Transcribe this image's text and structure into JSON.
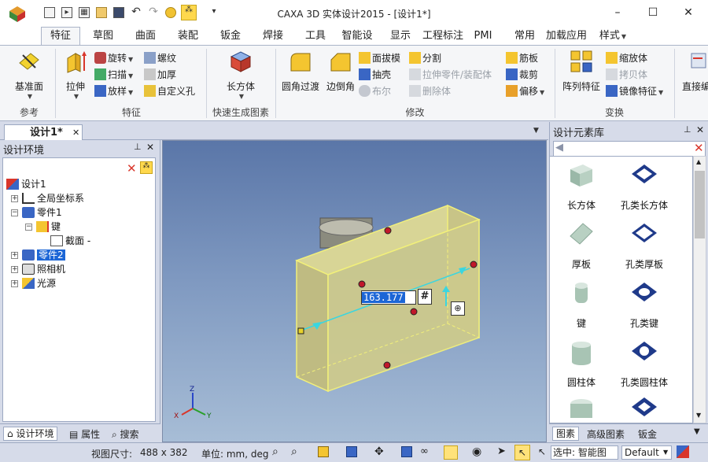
{
  "window": {
    "title": "CAXA 3D 实体设计2015 - [设计1*]",
    "minimize_icon": "minimize-icon",
    "maximize_icon": "maximize-icon",
    "close_icon": "close-icon"
  },
  "quick_access": [
    "new-icon",
    "open-icon",
    "print-icon",
    "folder-icon",
    "save-icon",
    "undo-icon",
    "redo-icon",
    "smart-icon",
    "catalog-icon",
    "customize-dropdown-icon"
  ],
  "ribbon_tabs": [
    {
      "label": "特征",
      "active": true
    },
    {
      "label": "草图"
    },
    {
      "label": "曲面"
    },
    {
      "label": "装配"
    },
    {
      "label": "钣金"
    },
    {
      "label": "焊接"
    },
    {
      "label": "工具"
    },
    {
      "label": "智能设计"
    },
    {
      "label": "显示"
    },
    {
      "label": "工程标注"
    },
    {
      "label": "PMI"
    },
    {
      "label": "常用"
    },
    {
      "label": "加载应用"
    },
    {
      "label": "样式"
    }
  ],
  "ribbon": {
    "ref_group": {
      "label": "参考",
      "base_plane": "基准面"
    },
    "feature_group": {
      "label": "特征",
      "extrude": "拉伸",
      "revolve": "旋转",
      "sweep": "扫描",
      "loft": "放样",
      "thread": "螺纹",
      "thicken": "加厚",
      "custom_hole": "自定义孔"
    },
    "quick_group": {
      "label": "快速生成图素",
      "block": "长方体"
    },
    "modify_group": {
      "label": "修改",
      "fillet": "圆角过渡",
      "chamfer": "边倒角",
      "draft": "面拔模",
      "shell": "抽壳",
      "boolean": "布尔",
      "split": "分割",
      "stretch_part": "拉伸零件/装配体",
      "delete_body": "删除体",
      "rib": "筋板",
      "trim": "裁剪",
      "offset": "偏移"
    },
    "transform_group": {
      "label": "变换",
      "pattern": "阵列特征",
      "scale": "缩放体",
      "copy": "拷贝体",
      "mirror": "镜像特征"
    },
    "direct_edit": "直接编"
  },
  "document_tab": {
    "label": "设计1*"
  },
  "left_panel": {
    "title": "设计环境",
    "tree": [
      {
        "label": "设计1",
        "level": 0
      },
      {
        "label": "全局坐标系",
        "level": 1
      },
      {
        "label": "零件1",
        "level": 1
      },
      {
        "label": "键",
        "level": 2
      },
      {
        "label": "截面 -",
        "level": 3
      },
      {
        "label": "零件2",
        "level": 1,
        "selected": true
      },
      {
        "label": "照相机",
        "level": 1
      },
      {
        "label": "光源",
        "level": 1
      }
    ],
    "bottom_tabs": [
      "设计环境",
      "属性",
      "搜索"
    ]
  },
  "viewport": {
    "dimension_value": "163.177",
    "hash_symbol": "#"
  },
  "right_panel": {
    "title": "设计元素库",
    "items": [
      "长方体",
      "孔类长方体",
      "厚板",
      "孔类厚板",
      "键",
      "孔类键",
      "圆柱体",
      "孔类圆柱体"
    ],
    "bottom_tabs": [
      "图素",
      "高级图素",
      "钣金"
    ]
  },
  "status_bar": {
    "view_size_label": "视图尺寸:",
    "view_size": "488 x 382",
    "units": "单位: mm, deg",
    "select_mode": "选中: 智能图",
    "style": "Default"
  },
  "colors": {
    "ribbon_bg": "#f5f6f8",
    "panel_bg": "#d6dbe9",
    "viewport_top": "#5a76a8",
    "viewport_bottom": "#a7bdd6",
    "part_fill": "#cfcc93",
    "part_edge": "#f2f07a",
    "selection_blue": "#1c66d6",
    "dim_cyan": "#3ad6e0"
  }
}
